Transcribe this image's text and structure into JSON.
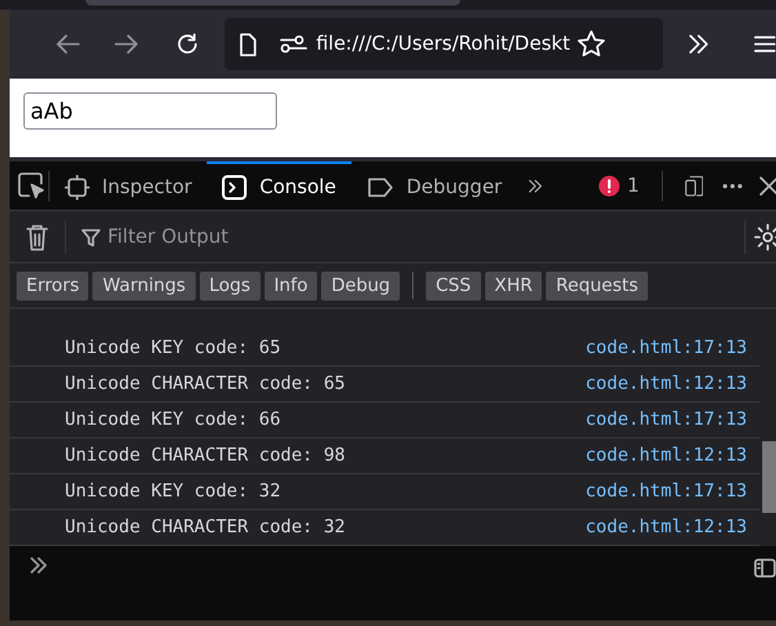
{
  "browser": {
    "back": {
      "disabled": true
    },
    "forward": {
      "disabled": true
    },
    "url": "file:///C:/Users/Rohit/Deskt"
  },
  "page": {
    "text_input": {
      "value": "aAb"
    }
  },
  "devtools": {
    "tabs": [
      {
        "label": "Inspector",
        "kind": "inspector",
        "selected": false
      },
      {
        "label": "Console",
        "kind": "console",
        "selected": true
      },
      {
        "label": "Debugger",
        "kind": "debugger",
        "selected": false
      }
    ],
    "error_count": "1",
    "filter": {
      "placeholder": "Filter Output"
    },
    "filter_groups": [
      [
        "Errors",
        "Warnings",
        "Logs",
        "Info",
        "Debug"
      ],
      [
        "CSS",
        "XHR",
        "Requests"
      ]
    ],
    "log": [
      {
        "message": "Unicode KEY code: 65",
        "source": "code.html:17:13"
      },
      {
        "message": "Unicode CHARACTER code: 65",
        "source": "code.html:12:13"
      },
      {
        "message": "Unicode KEY code: 66",
        "source": "code.html:17:13"
      },
      {
        "message": "Unicode CHARACTER code: 98",
        "source": "code.html:12:13"
      },
      {
        "message": "Unicode KEY code: 32",
        "source": "code.html:17:13"
      },
      {
        "message": "Unicode CHARACTER code: 32",
        "source": "code.html:12:13"
      }
    ]
  }
}
